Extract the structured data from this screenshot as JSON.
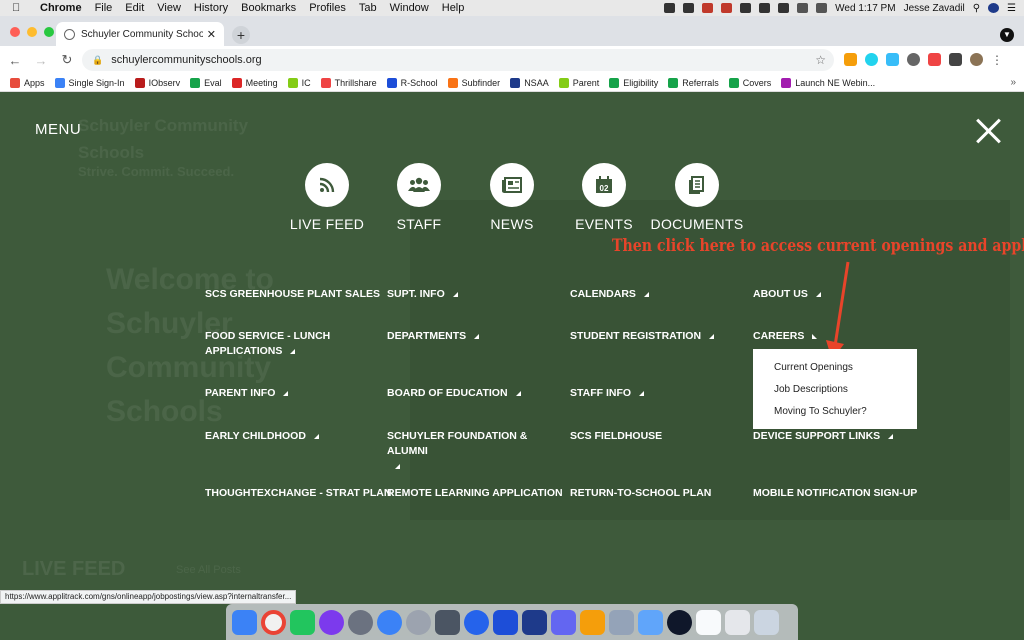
{
  "macbar": {
    "app": "Chrome",
    "menus": [
      "File",
      "Edit",
      "View",
      "History",
      "Bookmarks",
      "Profiles",
      "Tab",
      "Window",
      "Help"
    ],
    "clock": "Wed 1:17 PM",
    "user": "Jesse Zavadil"
  },
  "tab": {
    "title": "Schuyler Community Schools |"
  },
  "address": {
    "url": "schuylercommunityschools.org"
  },
  "bookmarks": [
    "Apps",
    "Single Sign-In",
    "IObserv",
    "Eval",
    "Meeting",
    "IC",
    "Thrillshare",
    "R-School",
    "Subfinder",
    "NSAA",
    "Parent",
    "Eligibility",
    "Referrals",
    "Covers",
    "Launch NE Webin..."
  ],
  "bookmark_colors": [
    "#e74c3c",
    "#3b82f6",
    "#b91c1c",
    "#16a34a",
    "#dc2626",
    "#84cc16",
    "#ef4444",
    "#1d4ed8",
    "#f97316",
    "#1e3a8a",
    "#84cc16",
    "#16a34a",
    "#16a34a",
    "#16a34a",
    "#a21caf"
  ],
  "page": {
    "menu_label": "MENU",
    "bg_school_name": "Schuyler Community Schools",
    "bg_tagline": "Strive. Commit. Succeed.",
    "bg_welcome": "Welcome to Schuyler Community Schools",
    "bg_live_feed": "LIVE FEED",
    "bg_see_all": "See All Posts",
    "quick_links": [
      {
        "label": "LIVE FEED",
        "icon": "rss-icon"
      },
      {
        "label": "STAFF",
        "icon": "people-icon"
      },
      {
        "label": "NEWS",
        "icon": "newspaper-icon"
      },
      {
        "label": "EVENTS",
        "icon": "calendar-icon",
        "day": "02"
      },
      {
        "label": "DOCUMENTS",
        "icon": "document-icon"
      }
    ],
    "annotation": "Then click here to access current openings and apply",
    "nav": {
      "col1": [
        "SCS GREENHOUSE PLANT SALES",
        "FOOD SERVICE - LUNCH APPLICATIONS",
        "PARENT INFO",
        "EARLY CHILDHOOD",
        "THOUGHTEXCHANGE - STRAT PLAN"
      ],
      "col2": [
        "SUPT. INFO",
        "DEPARTMENTS",
        "BOARD OF EDUCATION",
        "SCHUYLER FOUNDATION & ALUMNI",
        "REMOTE LEARNING APPLICATION"
      ],
      "col3": [
        "CALENDARS",
        "STUDENT REGISTRATION",
        "STAFF INFO",
        "SCS FIELDHOUSE",
        "RETURN-TO-SCHOOL PLAN"
      ],
      "col4": [
        "ABOUT US",
        "CAREERS",
        "DEVICE SUPPORT LINKS",
        "MOBILE NOTIFICATION SIGN-UP"
      ]
    },
    "careers_dropdown": [
      "Current Openings",
      "Job Descriptions",
      "Moving To Schuyler?"
    ]
  },
  "status_url": "https://www.applitrack.com/gns/onlineapp/jobpostings/view.asp?internaltransfer...",
  "accent_green": "#3e5a3b",
  "annotation_red": "#e8442a"
}
